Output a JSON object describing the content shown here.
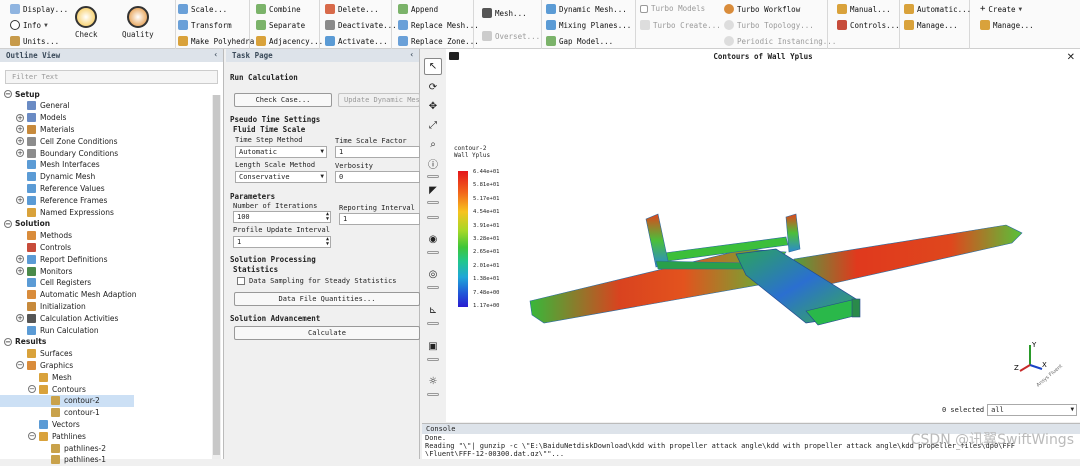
{
  "ribbon": {
    "display": "Display...",
    "info": "Info",
    "units": "Units...",
    "check": "Check",
    "quality": "Quality",
    "scale": "Scale...",
    "transform": "Transform",
    "make_polyhedra": "Make Polyhedra",
    "combine": "Combine",
    "separate": "Separate",
    "adjacency": "Adjacency...",
    "delete": "Delete...",
    "deactivate": "Deactivate...",
    "activate": "Activate...",
    "append": "Append",
    "replace_mesh": "Replace Mesh...",
    "replace_zone": "Replace Zone...",
    "mesh": "Mesh...",
    "overset": "Overset...",
    "dynamic_mesh": "Dynamic Mesh...",
    "mixing_planes": "Mixing Planes...",
    "gap_model": "Gap Model...",
    "turbo_models": "Turbo Models",
    "turbo_create": "Turbo Create...",
    "turbo_workflow": "Turbo Workflow",
    "turbo_topology": "Turbo Topology...",
    "periodic_instancing": "Periodic Instancing...",
    "manual": "Manual...",
    "controls": "Controls...",
    "automatic": "Automatic...",
    "manage": "Manage...",
    "create": "Create",
    "manage2": "Manage..."
  },
  "outline": {
    "title": "Outline View",
    "filter_placeholder": "Filter Text",
    "items": [
      {
        "label": "Setup",
        "level": 0,
        "toggle": "−",
        "section": true
      },
      {
        "label": "General",
        "level": 1,
        "color": "#6a8bc4"
      },
      {
        "label": "Models",
        "level": 1,
        "toggle": "+",
        "color": "#6a8bc4"
      },
      {
        "label": "Materials",
        "level": 1,
        "toggle": "+",
        "color": "#c78a3c"
      },
      {
        "label": "Cell Zone Conditions",
        "level": 1,
        "toggle": "+",
        "color": "#8c8c8c"
      },
      {
        "label": "Boundary Conditions",
        "level": 1,
        "toggle": "+",
        "color": "#8c8c8c"
      },
      {
        "label": "Mesh Interfaces",
        "level": 1,
        "color": "#5b9bd5"
      },
      {
        "label": "Dynamic Mesh",
        "level": 1,
        "color": "#5b9bd5"
      },
      {
        "label": "Reference Values",
        "level": 1,
        "color": "#5b9bd5"
      },
      {
        "label": "Reference Frames",
        "level": 1,
        "toggle": "+",
        "color": "#5b9bd5"
      },
      {
        "label": "Named Expressions",
        "level": 1,
        "color": "#d9a23b"
      },
      {
        "label": "Solution",
        "level": 0,
        "toggle": "−",
        "section": true
      },
      {
        "label": "Methods",
        "level": 1,
        "color": "#d98c3b"
      },
      {
        "label": "Controls",
        "level": 1,
        "color": "#c74c3b"
      },
      {
        "label": "Report Definitions",
        "level": 1,
        "toggle": "+",
        "color": "#5b9bd5"
      },
      {
        "label": "Monitors",
        "level": 1,
        "toggle": "+",
        "color": "#4a8a4a"
      },
      {
        "label": "Cell Registers",
        "level": 1,
        "color": "#5b9bd5"
      },
      {
        "label": "Automatic Mesh Adaption",
        "level": 1,
        "color": "#d98c3b"
      },
      {
        "label": "Initialization",
        "level": 1,
        "color": "#c78a3c"
      },
      {
        "label": "Calculation Activities",
        "level": 1,
        "toggle": "+",
        "color": "#555555"
      },
      {
        "label": "Run Calculation",
        "level": 1,
        "color": "#5b9bd5"
      },
      {
        "label": "Results",
        "level": 0,
        "toggle": "−",
        "section": true
      },
      {
        "label": "Surfaces",
        "level": 1,
        "color": "#d9a23b"
      },
      {
        "label": "Graphics",
        "level": 1,
        "toggle": "−",
        "color": "#d98c3b"
      },
      {
        "label": "Mesh",
        "level": 2,
        "color": "#d9a23b"
      },
      {
        "label": "Contours",
        "level": 2,
        "toggle": "−",
        "color": "#d9a23b"
      },
      {
        "label": "contour-2",
        "level": 3,
        "color": "#c9a24b",
        "selected": true
      },
      {
        "label": "contour-1",
        "level": 3,
        "color": "#c9a24b"
      },
      {
        "label": "Vectors",
        "level": 2,
        "color": "#5b9bd5"
      },
      {
        "label": "Pathlines",
        "level": 2,
        "toggle": "−",
        "color": "#d9a23b"
      },
      {
        "label": "pathlines-2",
        "level": 3,
        "color": "#c9a24b"
      },
      {
        "label": "pathlines-1",
        "level": 3,
        "color": "#c9a24b"
      }
    ]
  },
  "task": {
    "title": "Task Page",
    "heading": "Run Calculation",
    "check_case": "Check Case...",
    "update_dynamic_mesh": "Update Dynamic Mesh",
    "pseudo_time_settings": "Pseudo Time Settings",
    "fluid_time_scale": "Fluid Time Scale",
    "time_step_method_label": "Time Step Method",
    "time_step_method": "Automatic",
    "time_scale_factor_label": "Time Scale Factor",
    "time_scale_factor": "1",
    "length_scale_method_label": "Length Scale Method",
    "length_scale_method": "Conservative",
    "verbosity_label": "Verbosity",
    "verbosity": "0",
    "parameters": "Parameters",
    "num_iterations_label": "Number of Iterations",
    "num_iterations": "100",
    "reporting_interval_label": "Reporting Interval",
    "reporting_interval": "1",
    "profile_update_label": "Profile Update Interval",
    "profile_update": "1",
    "solution_processing": "Solution Processing",
    "statistics": "Statistics",
    "data_sampling": "Data Sampling for Steady Statistics",
    "data_file_quantities": "Data File Quantities...",
    "solution_advancement": "Solution Advancement",
    "calculate": "Calculate"
  },
  "graphics": {
    "title": "Contours of Wall Yplus",
    "legend_title": "contour-2",
    "legend_sub": "Wall Yplus",
    "legend_ticks": [
      "6.44e+01",
      "5.81e+01",
      "5.17e+01",
      "4.54e+01",
      "3.91e+01",
      "3.28e+01",
      "2.65e+01",
      "2.01e+01",
      "1.38e+01",
      "7.48e+00",
      "1.17e+00"
    ],
    "selected_label": "0 selected",
    "selected_value": "all",
    "axis_x": "X",
    "axis_y": "Y",
    "axis_z": "Z",
    "fluent_label": "Ansys Fluent"
  },
  "console": {
    "title": "Console",
    "lines": [
      "Done.",
      "Reading \"\\\"| gunzip -c \\\"E:\\BaiduNetdiskDownload\\kdd with propeller attack angle\\kdd with propeller attack angle\\kdd propeller_files\\dp0\\FFF",
      "\\Fluent\\FFF-12-00300.dat.gz\\\"\"..."
    ],
    "watermark": "CSDN @讯翼SwiftWings"
  }
}
